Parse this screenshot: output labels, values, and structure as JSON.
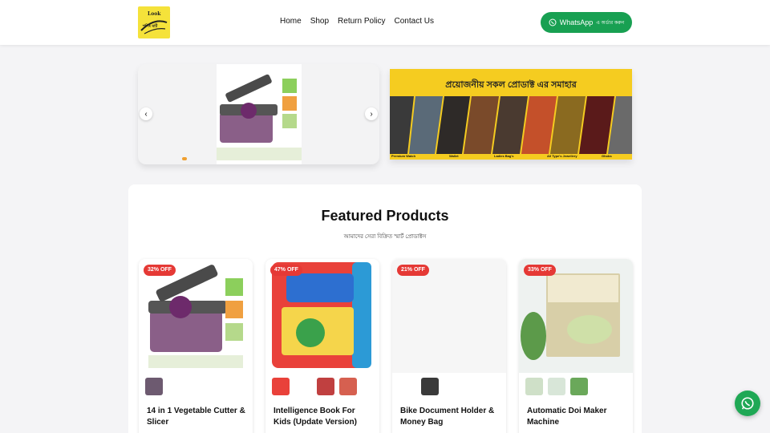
{
  "logo": {
    "top_text": "Look",
    "bottom_text": "শপিং মার্ট"
  },
  "nav": {
    "items": [
      "Home",
      "Shop",
      "Return Policy",
      "Contact Us"
    ]
  },
  "whatsapp_button": {
    "label": "WhatsApp",
    "sub": "এ অর্ডার করুন"
  },
  "slider": {
    "prev": "‹",
    "next": "›",
    "active_slide": 1
  },
  "banner": {
    "title": "প্রয়োজনীয় সকল প্রোডাক্ট এর সমাহার",
    "labels": [
      "Premium Watch",
      "Wallet",
      "Ladies Bag's",
      "All Type's Jewellery",
      "Ghobs"
    ]
  },
  "featured": {
    "title": "Featured Products",
    "subtitle": "আমাদের সেরা বিক্রিত স্মার্ট প্রোডাক্টস",
    "products": [
      {
        "badge": "32% OFF",
        "name": "14 in 1 Vegetable Cutter & Slicer"
      },
      {
        "badge": "47% OFF",
        "name": "Intelligence Book For Kids (Update Version)"
      },
      {
        "badge": "21% OFF",
        "name": "Bike Document Holder & Money Bag"
      },
      {
        "badge": "33% OFF",
        "name": "Automatic Doi Maker Machine"
      }
    ]
  },
  "colors": {
    "accent": "#18a052",
    "badge": "#e53935",
    "banner": "#f5cc20"
  }
}
